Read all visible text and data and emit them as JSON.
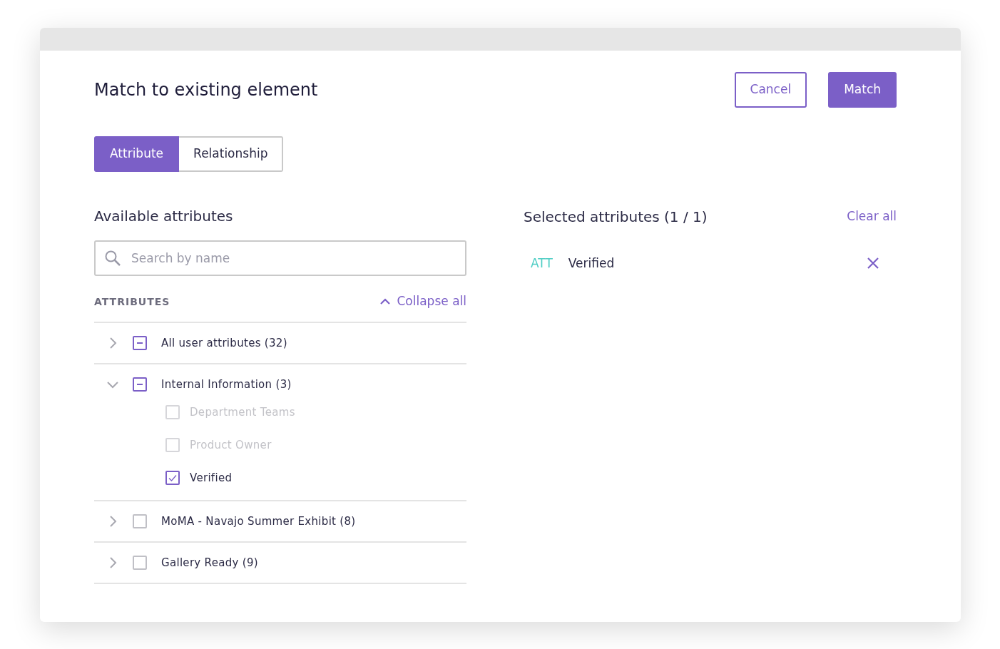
{
  "dialog": {
    "title": "Match to existing element",
    "buttons": [
      {
        "label": "Cancel",
        "kind": "outline"
      },
      {
        "label": "Match",
        "kind": "primary"
      }
    ]
  },
  "tabs": [
    {
      "label": "Attribute",
      "selected": true
    },
    {
      "label": "Relationship",
      "selected": false
    }
  ],
  "available": {
    "heading": "Available attributes",
    "search": {
      "placeholder": "Search by name"
    },
    "section_label": "ATTRIBUTES",
    "collapse_all": "Collapse all",
    "groups": [
      {
        "label": "All user attributes (32)",
        "expanded": false,
        "checked": false,
        "indeterminate": true
      },
      {
        "label": "Internal Information (3)",
        "expanded": true,
        "checked": false,
        "indeterminate": true,
        "children": [
          {
            "label": "Department Teams",
            "checked": false,
            "disabled": true
          },
          {
            "label": "Product Owner",
            "checked": false,
            "disabled": true
          },
          {
            "label": "Verified",
            "checked": true,
            "disabled": false
          }
        ]
      },
      {
        "label": "MoMA - Navajo Summer Exhibit (8)",
        "expanded": false,
        "checked": false,
        "indeterminate": false
      },
      {
        "label": "Gallery Ready (9)",
        "expanded": false,
        "checked": false,
        "indeterminate": false
      }
    ]
  },
  "selected": {
    "heading": "Selected attributes (1 / 1)",
    "clear_all": "Clear all",
    "items": [
      {
        "tag": "ATT",
        "label": "Verified"
      }
    ]
  }
}
